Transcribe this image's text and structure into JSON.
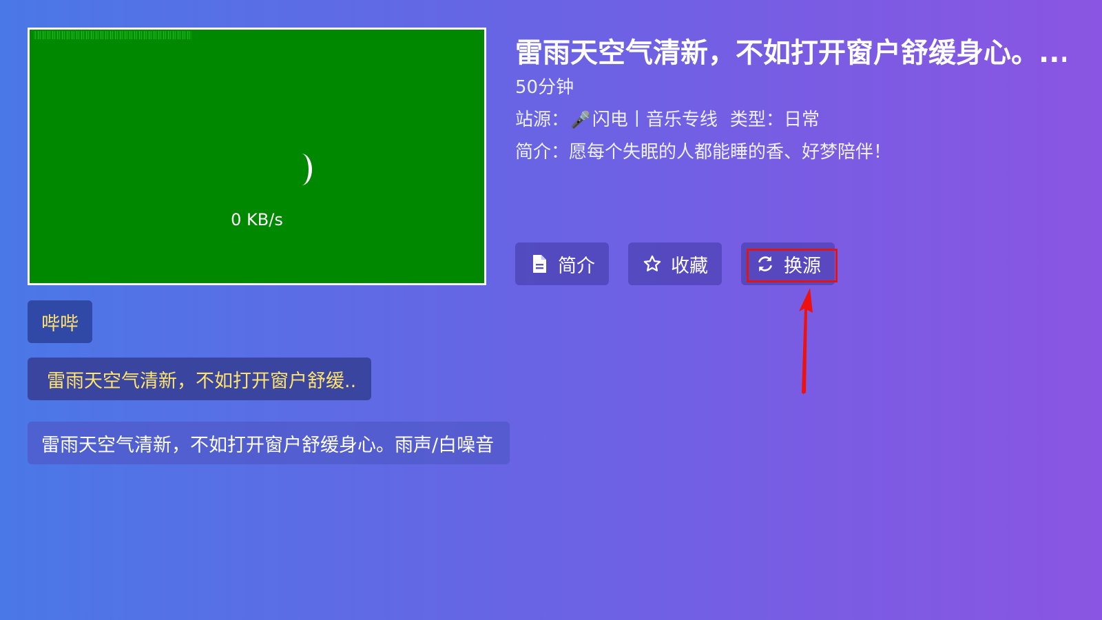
{
  "player": {
    "speed_text": "0 KB/s"
  },
  "detail": {
    "title": "雷雨天空气清新，不如打开窗户舒缓身心。...",
    "duration": "50分钟",
    "source_label": "站源：",
    "source_value": "闪电丨音乐专线",
    "type_label": "类型：",
    "type_value": "日常",
    "intro_label": "简介：",
    "intro_value": "愿每个失眠的人都能睡的香、好梦陪伴！"
  },
  "actions": {
    "intro_label": "简介",
    "favorite_label": "收藏",
    "switch_source_label": "换源"
  },
  "chips": {
    "source_name": "哔哔",
    "episode": "雷雨天空气清新，不如打开窗户舒缓..",
    "full_title": "雷雨天空气清新，不如打开窗户舒缓身心。雨声/白噪音"
  },
  "colors": {
    "player_bg": "#008800",
    "accent_yellow": "#ffe36a",
    "highlight_red": "#e01414"
  },
  "icons": {
    "intro": "document-icon",
    "favorite": "star-outline-icon",
    "switch_source": "refresh-icon",
    "source": "microphone-icon"
  }
}
